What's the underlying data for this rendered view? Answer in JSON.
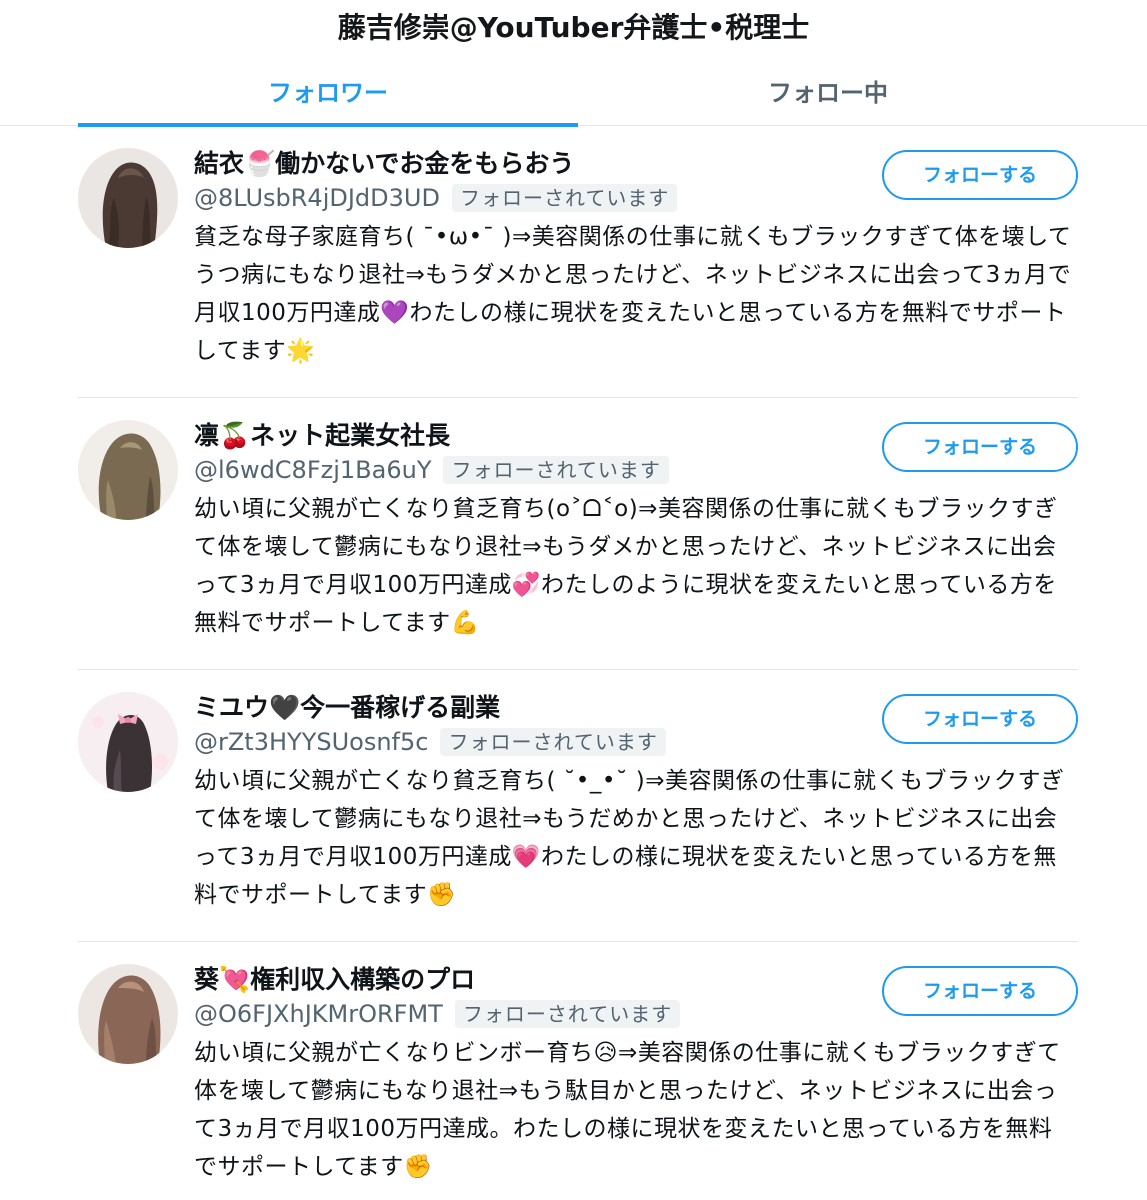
{
  "header": {
    "title": "藤吉修崇@YouTuber弁護士•税理士"
  },
  "tabs": [
    {
      "label": "フォロワー",
      "active": true
    },
    {
      "label": "フォロー中",
      "active": false
    }
  ],
  "colors": {
    "accent": "#1d9bf0",
    "text": "#0f1419",
    "muted": "#536471",
    "divider": "#e1e8ed"
  },
  "users": [
    {
      "name": "結衣🍧働かないでお金をもらおう",
      "handle": "@8LUsbR4jDJdD3UD",
      "follows_you": "フォローされています",
      "follow_button": "フォローする",
      "bio": "貧乏な母子家庭育ち( ˉ•ω•ˉ )⇒美容関係の仕事に就くもブラックすぎて体を壊してうつ病にもなり退社⇒もうダメかと思ったけど、ネットビジネスに出会って3ヵ月で月収100万円達成💜わたしの様に現状を変えたいと思っている方を無料でサポートしてます🌟",
      "avatar_icon": "avatar-photo-dark-hair"
    },
    {
      "name": "凛🍒ネット起業女社長",
      "handle": "@l6wdC8Fzj1Ba6uY",
      "follows_you": "フォローされています",
      "follow_button": "フォローする",
      "bio": "幼い頃に父親が亡くなり貧乏育ち(o˃ᗝ˂o)⇒美容関係の仕事に就くもブラックすぎて体を壊して鬱病にもなり退社⇒もうダメかと思ったけど、ネットビジネスに出会って3ヵ月で月収100万円達成💞わたしのように現状を変えたいと思っている方を無料でサポートしてます💪",
      "avatar_icon": "avatar-photo-wavy-hair"
    },
    {
      "name": "ミユウ🖤今一番稼げる副業",
      "handle": "@rZt3HYYSUosnf5c",
      "follows_you": "フォローされています",
      "follow_button": "フォローする",
      "bio": "幼い頃に父親が亡くなり貧乏育ち( ˘•_•˘ )⇒美容関係の仕事に就くもブラックすぎて体を壊して鬱病にもなり退社⇒もうだめかと思ったけど、ネットビジネスに出会って3ヵ月で月収100万円達成💗わたしの様に現状を変えたいと思っている方を無料でサポートしてます✊",
      "avatar_icon": "avatar-photo-pink-bow"
    },
    {
      "name": "葵💘権利収入構築のプロ",
      "handle": "@O6FJXhJKMrORFMT",
      "follows_you": "フォローされています",
      "follow_button": "フォローする",
      "bio": "幼い頃に父親が亡くなりビンボー育ち😥⇒美容関係の仕事に就くもブラックすぎて体を壊して鬱病にもなり退社⇒もう駄目かと思ったけど、ネットビジネスに出会って3ヵ月で月収100万円達成。わたしの様に現状を変えたいと思っている方を無料でサポートしてます✊",
      "avatar_icon": "avatar-photo-brown-hair"
    }
  ]
}
